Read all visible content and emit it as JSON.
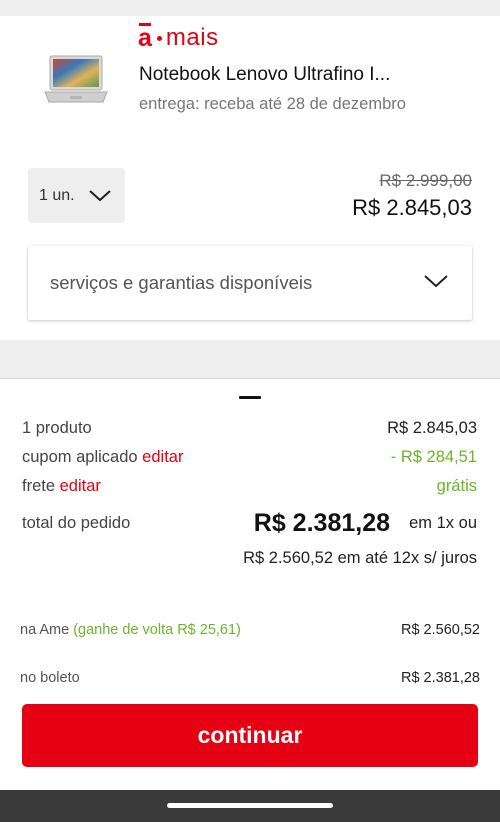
{
  "brand": {
    "mark": "a",
    "name": "mais"
  },
  "product": {
    "title": "Notebook Lenovo Ultrafino I...",
    "delivery": "entrega: receba até 28 de dezembro",
    "quantity": "1 un.",
    "old_price": "R$ 2.999,00",
    "price": "R$ 2.845,03",
    "image_icon": "laptop-icon"
  },
  "services": {
    "label": "serviços e garantias disponíveis",
    "icon": "chevron-down-icon"
  },
  "summary": {
    "products_label": "1 produto",
    "products_value": "R$ 2.845,03",
    "coupon_label": "cupom aplicado",
    "coupon_edit": "editar",
    "coupon_value": "- R$ 284,51",
    "shipping_label": "frete",
    "shipping_edit": "editar",
    "shipping_value": "grátis",
    "total_label": "total do pedido",
    "total_value": "R$ 2.381,28",
    "total_suffix": "em 1x ou",
    "installments": "R$ 2.560,52 em até 12x s/ juros"
  },
  "payment": {
    "ame_label": "na Ame",
    "ame_cashback": "(ganhe de volta R$ 25,61)",
    "ame_value": "R$ 2.560,52",
    "boleto_label": "no boleto",
    "boleto_value": "R$ 2.381,28"
  },
  "continue_button": "continuar",
  "colors": {
    "brand_red": "#e60014",
    "success_green": "#6cb42c"
  }
}
